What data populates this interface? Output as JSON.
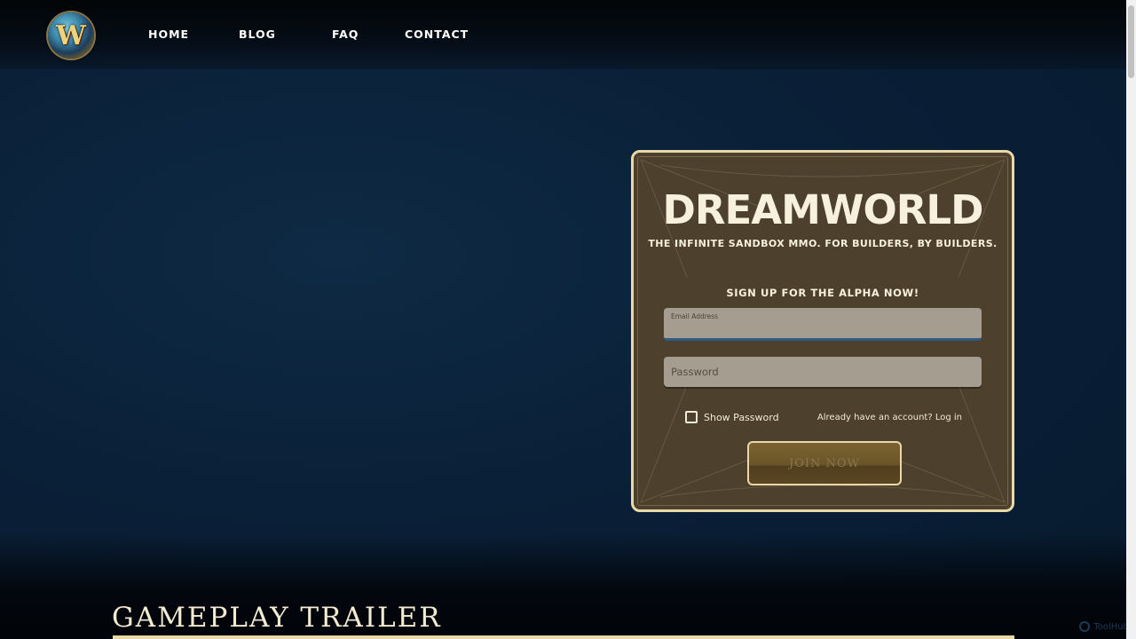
{
  "brand": {
    "logo_letter": "W",
    "logo_icon": "warcraft-style-crest-icon"
  },
  "nav": {
    "items": [
      "HOME",
      "BLOG",
      "FAQ",
      "CONTACT"
    ]
  },
  "signup": {
    "title": "DREAMWORLD",
    "tagline": "THE INFINITE SANDBOX MMO. FOR BUILDERS, BY BUILDERS.",
    "cta_heading": "SIGN UP FOR THE ALPHA NOW!",
    "email_label": "Email Address",
    "email_value": "",
    "password_placeholder": "Password",
    "show_password_label": "Show Password",
    "show_password_checked": false,
    "login_link": "Already have an account? Log in",
    "join_button": "JOIN NOW"
  },
  "section": {
    "trailer_title": "GAMEPLAY TRAILER"
  },
  "watermark": {
    "text": "ToolHub"
  },
  "colors": {
    "background": "#0a2038",
    "panel": "#4d402c",
    "panel_border": "#e8d9a8",
    "text_light": "#f7f0dd",
    "email_underline": "#2e5a84"
  }
}
